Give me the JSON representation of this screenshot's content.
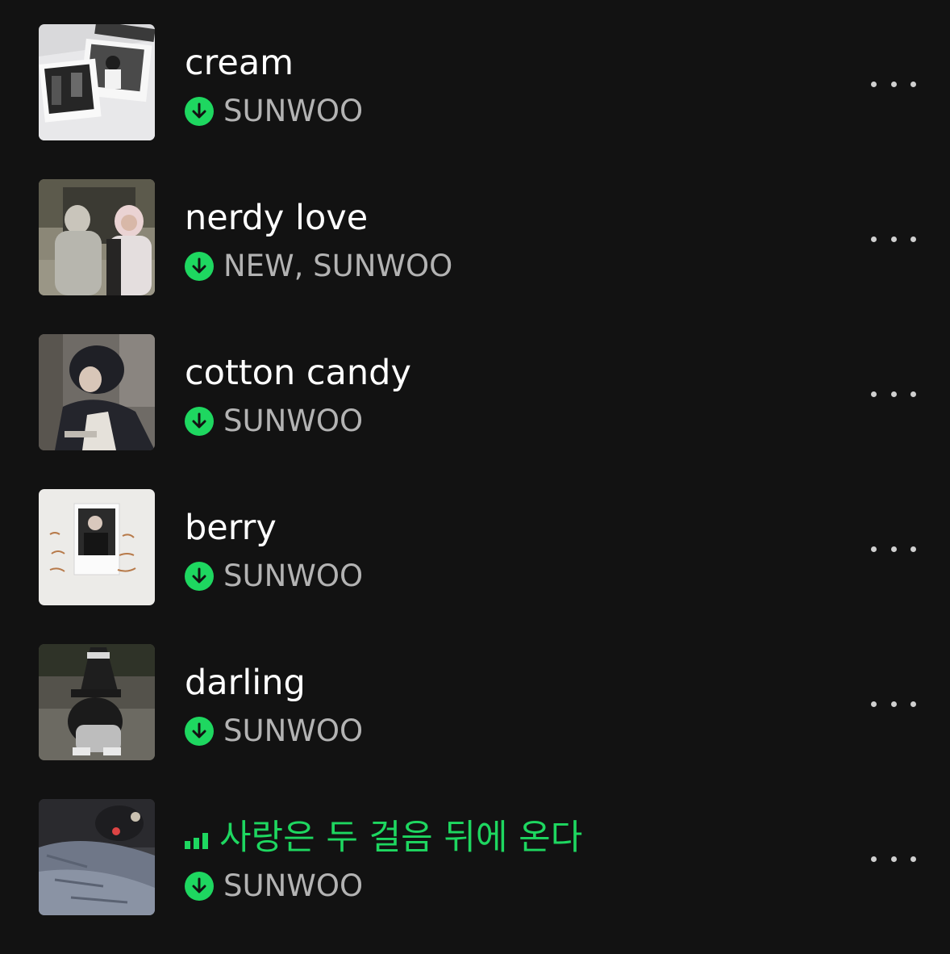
{
  "colors": {
    "background": "#121212",
    "title": "#ffffff",
    "artist": "#b3b3b3",
    "accent": "#1ed760",
    "more": "#cfcfcf"
  },
  "tracks": [
    {
      "title": "cream",
      "artist": "SUNWOO",
      "downloaded": true,
      "playing": false
    },
    {
      "title": "nerdy love",
      "artist": "NEW, SUNWOO",
      "downloaded": true,
      "playing": false
    },
    {
      "title": "cotton candy",
      "artist": "SUNWOO",
      "downloaded": true,
      "playing": false
    },
    {
      "title": "berry",
      "artist": "SUNWOO",
      "downloaded": true,
      "playing": false
    },
    {
      "title": "darling",
      "artist": "SUNWOO",
      "downloaded": true,
      "playing": false
    },
    {
      "title": "사랑은 두 걸음 뒤에 온다",
      "artist": "SUNWOO",
      "downloaded": true,
      "playing": true
    }
  ],
  "icons": {
    "download": "download-arrow-icon",
    "more": "more-options-icon",
    "playing": "equalizer-icon"
  }
}
